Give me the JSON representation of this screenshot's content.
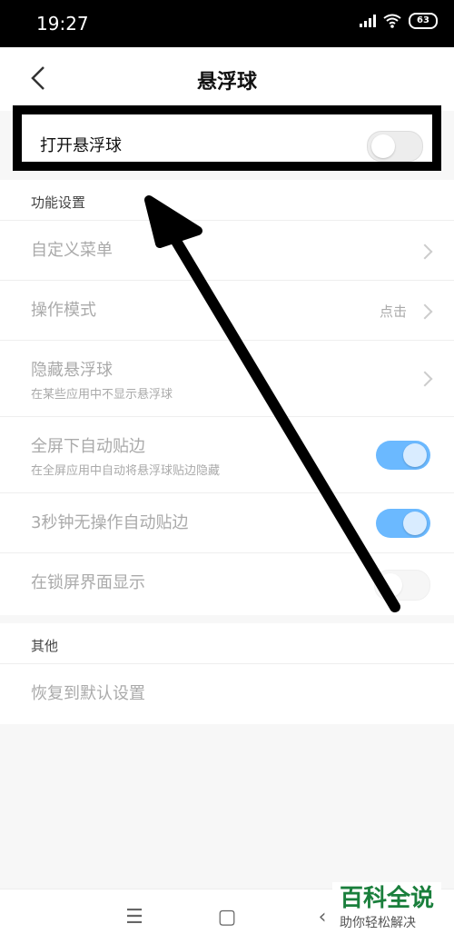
{
  "status": {
    "time": "19:27",
    "battery": "63"
  },
  "header": {
    "title": "悬浮球"
  },
  "main_toggle": {
    "label": "打开悬浮球",
    "state": "off"
  },
  "function_section": {
    "title": "功能设置",
    "items": [
      {
        "label": "自定义菜单",
        "sub": "",
        "value": ""
      },
      {
        "label": "操作模式",
        "sub": "",
        "value": "点击"
      },
      {
        "label": "隐藏悬浮球",
        "sub": "在某些应用中不显示悬浮球",
        "value": ""
      },
      {
        "label": "全屏下自动贴边",
        "sub": "在全屏应用中自动将悬浮球贴边隐藏",
        "value": ""
      },
      {
        "label": "3秒钟无操作自动贴边",
        "sub": "",
        "value": ""
      },
      {
        "label": "在锁屏界面显示",
        "sub": "",
        "value": ""
      }
    ]
  },
  "other_section": {
    "title": "其他",
    "items": [
      {
        "label": "恢复到默认设置"
      }
    ]
  },
  "watermark": {
    "title": "百科全说",
    "subtitle": "助你轻松解决"
  },
  "nav": {
    "menu": "☰",
    "home": "▢",
    "back": "‹"
  }
}
